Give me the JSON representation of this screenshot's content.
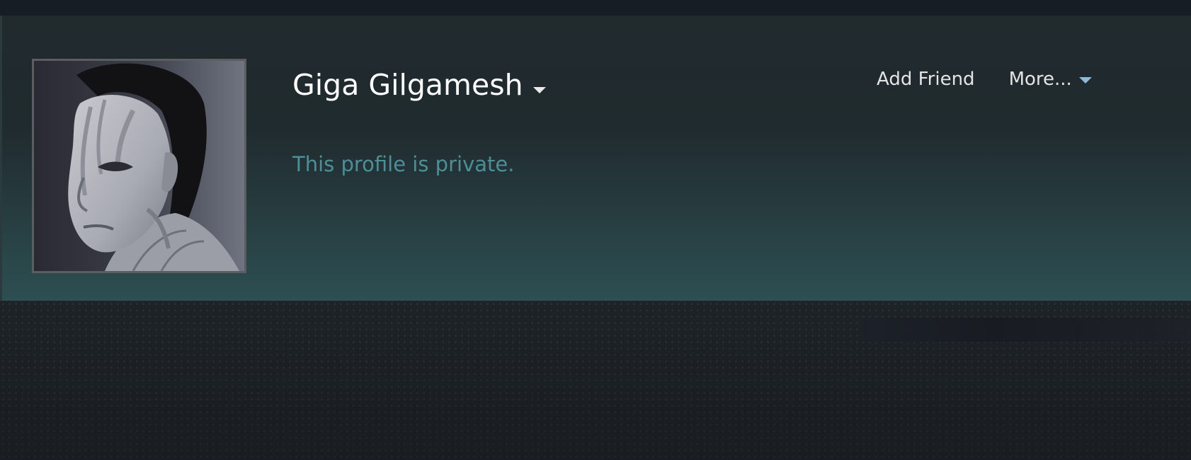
{
  "profile": {
    "name": "Giga Gilgamesh",
    "status": "This profile is private.",
    "avatar_alt": "Profile avatar"
  },
  "actions": {
    "add_friend": "Add Friend",
    "more": "More..."
  },
  "icons": {
    "name_menu": "caret-down-icon",
    "more_menu": "caret-down-icon"
  },
  "colors": {
    "status_text": "#4d8e97",
    "more_caret": "#8fb9d8",
    "header_top": "#212a2d",
    "header_bottom": "#2d4f52"
  }
}
